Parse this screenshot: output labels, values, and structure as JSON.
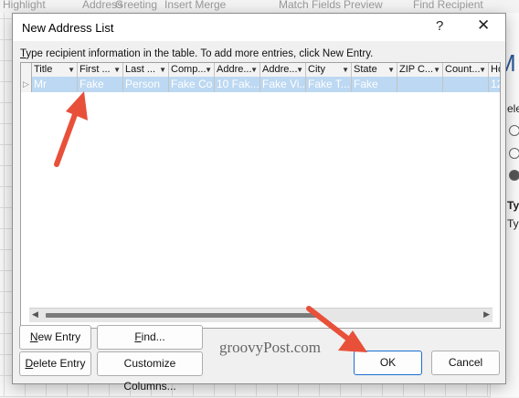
{
  "background": {
    "ribbon_items": [
      "Highlight",
      "Address",
      "Greeting",
      "Insert Merge",
      "Match Fields",
      "Preview",
      "Find Recipient"
    ],
    "pane_heading": "M",
    "pane_labels": [
      "ele",
      "Typ",
      "Typ"
    ]
  },
  "dialog": {
    "title": "New Address List",
    "help_glyph": "?",
    "close_glyph": "✕",
    "instruction_first": "T",
    "instruction_rest": "ype recipient information in the table.  To add more entries, click New Entry.",
    "columns": [
      "Title",
      "First ...",
      "Last ...",
      "Comp...",
      "Addre...",
      "Addre...",
      "City",
      "State",
      "ZIP C...",
      "Count...",
      "Ho"
    ],
    "row": [
      "Mr",
      "Fake",
      "Person",
      "Fake Co",
      "10 Fak...",
      "Fake Vi...",
      "Fake T...",
      "Fake",
      "",
      "",
      "12"
    ],
    "buttons": {
      "new_entry_u": "N",
      "new_entry_rest": "ew Entry",
      "find_u": "F",
      "find_rest": "ind...",
      "delete_entry_u": "D",
      "delete_entry_rest": "elete Entry",
      "customize_columns": "Customize Columns...",
      "ok": "OK",
      "cancel": "Cancel"
    }
  },
  "watermark": "groovyPost.com",
  "colors": {
    "arrow": "#e8503a",
    "selection": "#bcd8f2",
    "primary_border": "#1a6fd0"
  }
}
